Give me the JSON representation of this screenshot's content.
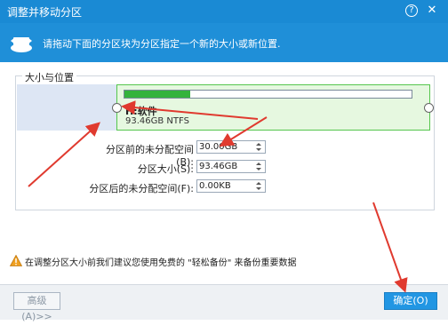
{
  "window": {
    "title": "调整并移动分区",
    "help_glyph": "?",
    "close_glyph": "✕"
  },
  "banner": {
    "instruction": "请拖动下面的分区块为分区指定一个新的大小或新位置."
  },
  "group": {
    "label": "大小与位置"
  },
  "partition": {
    "name": "H:软件",
    "size": "93.46GB NTFS",
    "usage_fraction": 0.23
  },
  "fields": {
    "before": {
      "label": "分区前的未分配空间(B):",
      "value": "30.00GB"
    },
    "size": {
      "label": "分区大小(S):",
      "value": "93.46GB"
    },
    "after": {
      "label": "分区后的未分配空间(F):",
      "value": "0.00KB"
    }
  },
  "warning": {
    "text": "在调整分区大小前我们建议您使用免费的 \"轻松备份\" 来备份重要数据"
  },
  "buttons": {
    "advanced": "高级(A)>>",
    "ok": "确定(O)"
  },
  "colors": {
    "title_bar": "#1a8ad4",
    "partition_fill": "#e6f8e0",
    "partition_border": "#55c64d",
    "usage_bar": "#34b33c",
    "unallocated": "#dde6f4",
    "ok_button": "#2196e3",
    "annotation_arrow": "#e03a2f"
  }
}
